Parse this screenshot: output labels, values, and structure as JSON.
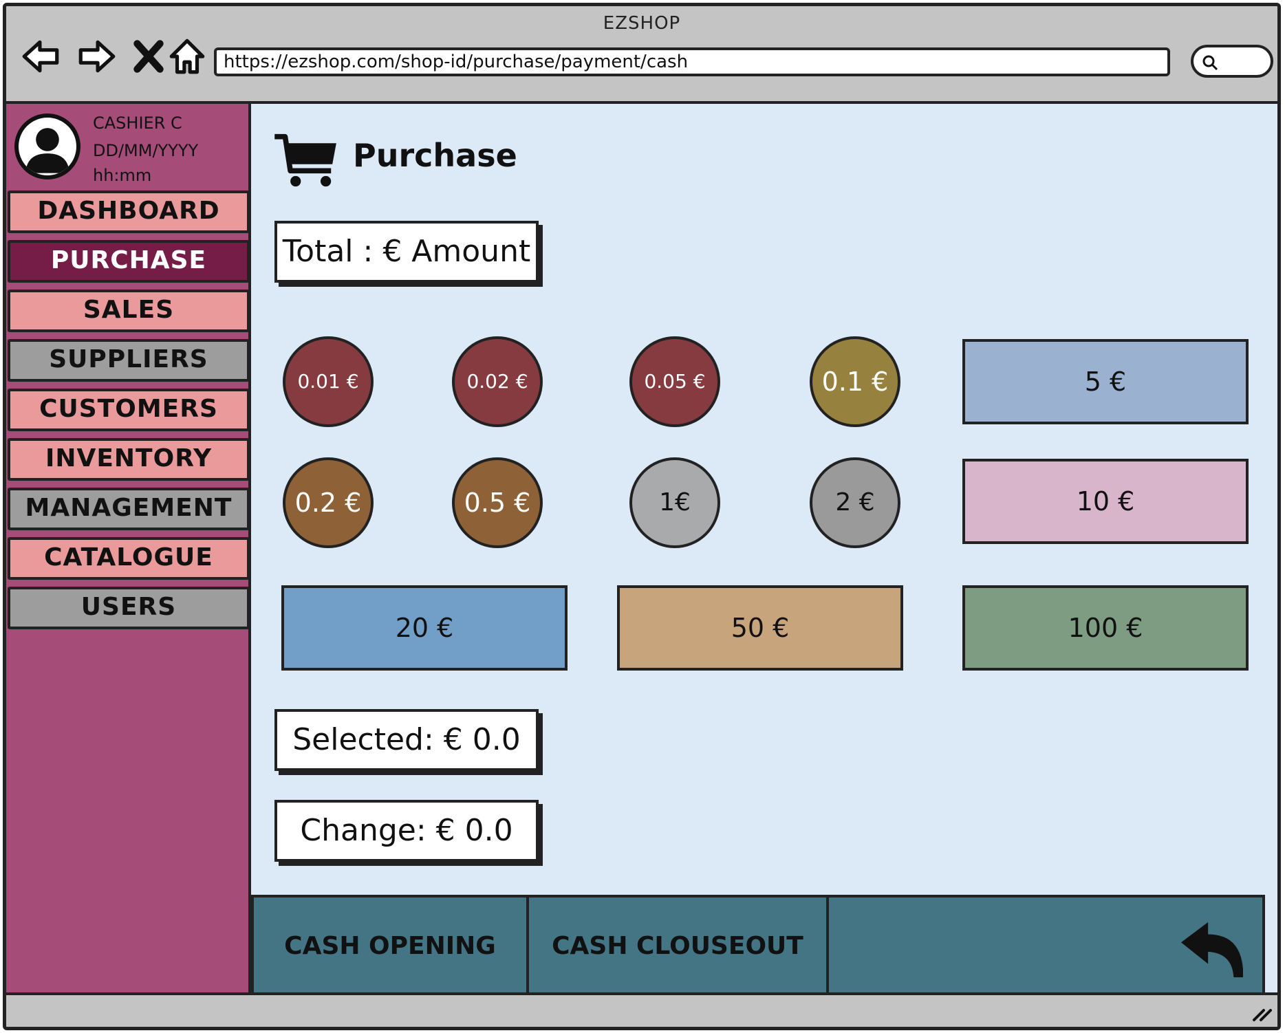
{
  "window": {
    "title": "EZSHOP"
  },
  "browser": {
    "url": "https://ezshop.com/shop-id/purchase/payment/cash",
    "icons": [
      "back-arrow-icon",
      "forward-arrow-icon",
      "close-x-icon",
      "home-icon",
      "search-icon"
    ]
  },
  "user": {
    "name": "CASHIER C",
    "date": "DD/MM/YYYY",
    "time": "hh:mm"
  },
  "sidebar": {
    "items": [
      {
        "label": "DASHBOARD",
        "style": "pink"
      },
      {
        "label": "PURCHASE",
        "style": "active"
      },
      {
        "label": "SALES",
        "style": "pink"
      },
      {
        "label": "SUPPLIERS",
        "style": "gray"
      },
      {
        "label": "CUSTOMERS",
        "style": "pink"
      },
      {
        "label": "INVENTORY",
        "style": "pink"
      },
      {
        "label": "MANAGEMENT",
        "style": "gray"
      },
      {
        "label": "CATALOGUE",
        "style": "pink"
      },
      {
        "label": "USERS",
        "style": "gray"
      }
    ]
  },
  "main": {
    "title": "Purchase",
    "total_label": "Total : € Amount",
    "selected_label": "Selected: € 0.0",
    "change_label": "Change: € 0.0"
  },
  "denominations": {
    "coins": [
      {
        "label": "0.01 €",
        "color": "#853b3f"
      },
      {
        "label": "0.02 €",
        "color": "#853b3f"
      },
      {
        "label": "0.05 €",
        "color": "#853b3f"
      },
      {
        "label": "0.1 €",
        "color": "#96813e"
      },
      {
        "label": "0.2 €",
        "color": "#8e6136"
      },
      {
        "label": "0.5 €",
        "color": "#8e6136"
      },
      {
        "label": "1€",
        "color": "#a9aaab"
      },
      {
        "label": "2 €",
        "color": "#9a9a9a"
      }
    ],
    "notes": [
      {
        "label": "5 €",
        "color": "#9ab2d0"
      },
      {
        "label": "10 €",
        "color": "#d8b5ca"
      },
      {
        "label": "20 €",
        "color": "#729fc7"
      },
      {
        "label": "50 €",
        "color": "#c8a47d"
      },
      {
        "label": "100 €",
        "color": "#7e9c82"
      }
    ]
  },
  "actions": {
    "cash_opening": "CASH OPENING",
    "cash_closeout": "CASH CLOUSEOUT",
    "back_icon": "undo-arrow-icon"
  },
  "colors": {
    "sidebar_bg": "#a54d78",
    "menu_pink": "#ea9a9a",
    "menu_gray": "#9d9d9d",
    "menu_active": "#751c47",
    "main_bg": "#dce9f6",
    "bottom_bar": "#437584"
  }
}
